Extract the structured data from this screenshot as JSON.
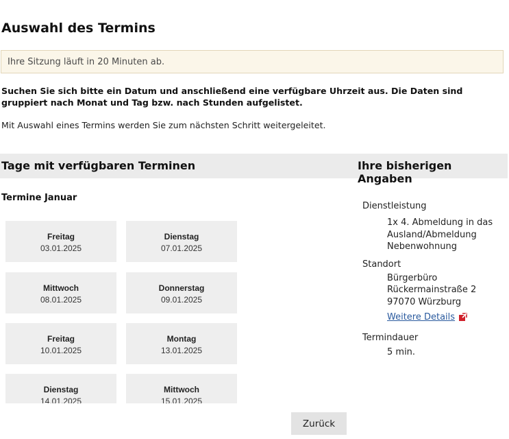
{
  "page": {
    "title": "Auswahl des Termins",
    "session_notice": "Ihre Sitzung läuft in 20 Minuten ab.",
    "instruction_bold": "Suchen Sie sich bitte ein Datum und anschließend eine verfügbare Uhrzeit aus. Die Daten sind gruppiert nach Monat und Tag bzw. nach Stunden aufgelistet.",
    "instruction": "Mit Auswahl eines Termins werden Sie zum nächsten Schritt weitergeleitet."
  },
  "days_section": {
    "heading": "Tage mit verfügbaren Terminen",
    "month_label": "Termine Januar",
    "days": [
      {
        "weekday": "Freitag",
        "date": "03.01.2025"
      },
      {
        "weekday": "Dienstag",
        "date": "07.01.2025"
      },
      {
        "weekday": "Mittwoch",
        "date": "08.01.2025"
      },
      {
        "weekday": "Donnerstag",
        "date": "09.01.2025"
      },
      {
        "weekday": "Freitag",
        "date": "10.01.2025"
      },
      {
        "weekday": "Montag",
        "date": "13.01.2025"
      },
      {
        "weekday": "Dienstag",
        "date": "14.01.2025"
      },
      {
        "weekday": "Mittwoch",
        "date": "15.01.2025"
      }
    ]
  },
  "summary": {
    "heading": "Ihre bisherigen Angaben",
    "service_label": "Dienstleistung",
    "service_lines": [
      "1x 4. Abmeldung in das",
      "Ausland/Abmeldung",
      "Nebenwohnung"
    ],
    "location_label": "Standort",
    "location_lines": [
      "Bürgerbüro",
      "Rückermainstraße 2",
      "97070 Würzburg"
    ],
    "details_link": "Weitere Details",
    "duration_label": "Termindauer",
    "duration_value": "5 min."
  },
  "actions": {
    "back_label": "Zurück"
  },
  "colors": {
    "link": "#2a5a9e",
    "external_icon": "#d0202a",
    "notice_bg": "#fbf6e9"
  },
  "icons": {
    "details": "external-link-icon"
  }
}
